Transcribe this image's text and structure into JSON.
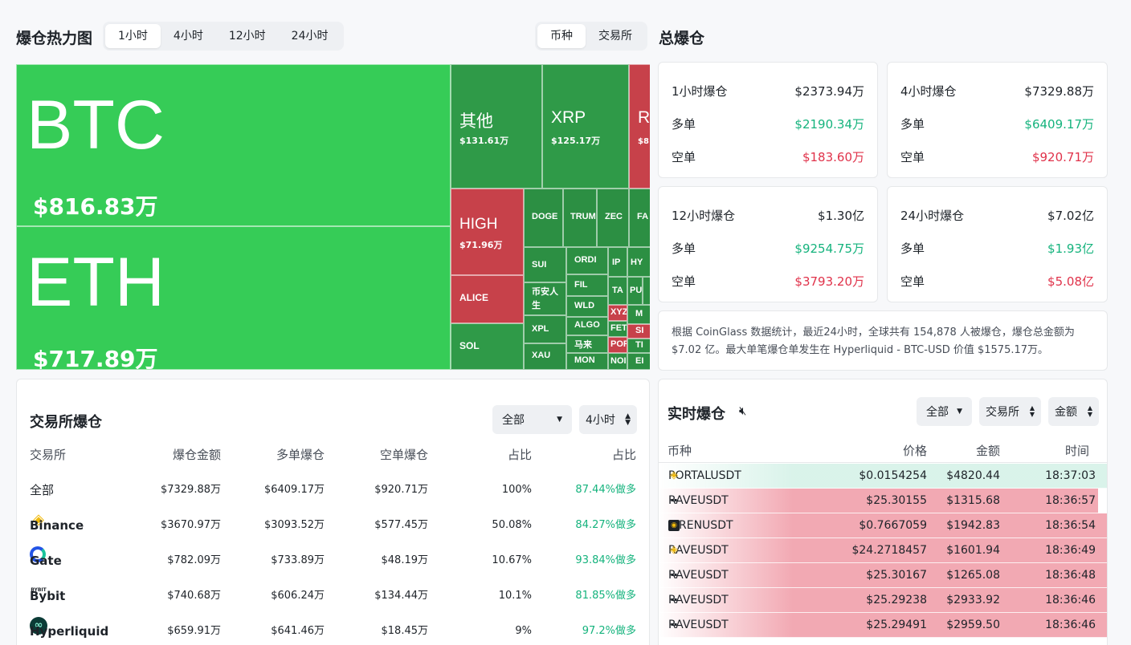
{
  "heatmap": {
    "title": "爆仓热力图",
    "time_tabs": [
      "1小时",
      "4小时",
      "12小时",
      "24小时"
    ],
    "active_time_tab": "1小时",
    "view_tabs": [
      "币种",
      "交易所"
    ],
    "active_view_tab": "币种",
    "tiles": {
      "btc": {
        "symbol": "BTC",
        "amount": "$816.83万"
      },
      "eth": {
        "symbol": "ETH",
        "amount": "$717.89万"
      },
      "other": {
        "symbol": "其他",
        "amount": "$131.61万"
      },
      "xrp": {
        "symbol": "XRP",
        "amount": "$125.17万"
      },
      "r": {
        "symbol": "R",
        "amount": "$8"
      },
      "high": {
        "symbol": "HIGH",
        "amount": "$71.96万"
      },
      "alice": {
        "symbol": "ALICE"
      },
      "sol": {
        "symbol": "SOL"
      },
      "doge": {
        "symbol": "DOGE"
      },
      "trump": {
        "symbol": "TRUM"
      },
      "zec": {
        "symbol": "ZEC"
      },
      "fa": {
        "symbol": "FA"
      },
      "sui": {
        "symbol": "SUI"
      },
      "bnrs": {
        "symbol": "币安人生"
      },
      "xpl": {
        "symbol": "XPL"
      },
      "xau": {
        "symbol": "XAU"
      },
      "ordi": {
        "symbol": "ORDI"
      },
      "fil": {
        "symbol": "FIL"
      },
      "wld": {
        "symbol": "WLD"
      },
      "algo": {
        "symbol": "ALGO"
      },
      "mala": {
        "symbol": "马来"
      },
      "mon": {
        "symbol": "MON"
      },
      "ip": {
        "symbol": "IP"
      },
      "hy": {
        "symbol": "HY"
      },
      "ta": {
        "symbol": "TA"
      },
      "pu": {
        "symbol": "PU"
      },
      "xy": {
        "symbol": "XYZ"
      },
      "m": {
        "symbol": "M"
      },
      "fet": {
        "symbol": "FET"
      },
      "si": {
        "symbol": "SI"
      },
      "por": {
        "symbol": "POR"
      },
      "ti": {
        "symbol": "TI"
      },
      "no": {
        "symbol": "NOI"
      },
      "ei": {
        "symbol": "EI"
      }
    }
  },
  "summary": {
    "title": "总爆仓",
    "long_label": "多单",
    "short_label": "空单",
    "cards": [
      {
        "label": "1小时爆仓",
        "total": "$2373.94万",
        "long": "$2190.34万",
        "short": "$183.60万"
      },
      {
        "label": "4小时爆仓",
        "total": "$7329.88万",
        "long": "$6409.17万",
        "short": "$920.71万"
      },
      {
        "label": "12小时爆仓",
        "total": "$1.30亿",
        "long": "$9254.75万",
        "short": "$3793.20万"
      },
      {
        "label": "24小时爆仓",
        "total": "$7.02亿",
        "long": "$1.93亿",
        "short": "$5.08亿"
      }
    ],
    "note": "根据 CoinGlass 数据统计，最近24小时，全球共有 154,878 人被爆仓，爆仓总金额为 $7.02 亿。最大单笔爆仓单发生在 Hyperliquid - BTC-USD 价值 $1575.17万。"
  },
  "exchange": {
    "title": "交易所爆仓",
    "filter_all": "全部",
    "filter_time": "4小时",
    "headers": [
      "交易所",
      "爆仓金额",
      "多单爆仓",
      "空单爆仓",
      "占比",
      "占比"
    ],
    "rows": [
      {
        "name": "全部",
        "amount": "$7329.88万",
        "long": "$6409.17万",
        "short": "$920.71万",
        "pct": "100%",
        "ratio": "87.44%做多"
      },
      {
        "name": "Binance",
        "amount": "$3670.97万",
        "long": "$3093.52万",
        "short": "$577.45万",
        "pct": "50.08%",
        "ratio": "84.27%做多"
      },
      {
        "name": "Gate",
        "amount": "$782.09万",
        "long": "$733.89万",
        "short": "$48.19万",
        "pct": "10.67%",
        "ratio": "93.84%做多"
      },
      {
        "name": "Bybit",
        "amount": "$740.68万",
        "long": "$606.24万",
        "short": "$134.44万",
        "pct": "10.1%",
        "ratio": "81.85%做多"
      },
      {
        "name": "Hyperliquid",
        "amount": "$659.91万",
        "long": "$641.46万",
        "short": "$18.45万",
        "pct": "9%",
        "ratio": "97.2%做多"
      }
    ],
    "logo_text": {
      "bybit": "BYBIT"
    }
  },
  "realtime": {
    "title": "实时爆仓",
    "filter_all": "全部",
    "filter_exchange": "交易所",
    "filter_amount": "金额",
    "headers": [
      "币种",
      "价格",
      "金额",
      "时间"
    ],
    "rows": [
      {
        "coin": "PORTALUSDT",
        "price": "$0.0154254",
        "amount": "$4820.44",
        "time": "18:37:03",
        "side": "long",
        "fill": 1.0
      },
      {
        "coin": "RAVEUSDT",
        "price": "$25.30155",
        "amount": "$1315.68",
        "time": "18:36:57",
        "side": "short",
        "fill": 0.98
      },
      {
        "coin": "SIRENUSDT",
        "price": "$0.7667059",
        "amount": "$1942.83",
        "time": "18:36:54",
        "side": "short",
        "fill": 1.0
      },
      {
        "coin": "RAVEUSDT",
        "price": "$24.2718457",
        "amount": "$1601.94",
        "time": "18:36:49",
        "side": "short",
        "fill": 1.0
      },
      {
        "coin": "RAVEUSDT",
        "price": "$25.30167",
        "amount": "$1265.08",
        "time": "18:36:48",
        "side": "short",
        "fill": 1.0
      },
      {
        "coin": "RAVEUSDT",
        "price": "$25.29238",
        "amount": "$2933.92",
        "time": "18:36:46",
        "side": "short",
        "fill": 1.0
      },
      {
        "coin": "RAVEUSDT",
        "price": "$25.29491",
        "amount": "$2959.50",
        "time": "18:36:46",
        "side": "short",
        "fill": 1.0
      }
    ]
  },
  "colors": {
    "green": "#15b37d",
    "red": "#e0324a",
    "tile_green": "#36cc57",
    "tile_dark_green": "#2f9a48",
    "tile_red": "#c7414a"
  }
}
